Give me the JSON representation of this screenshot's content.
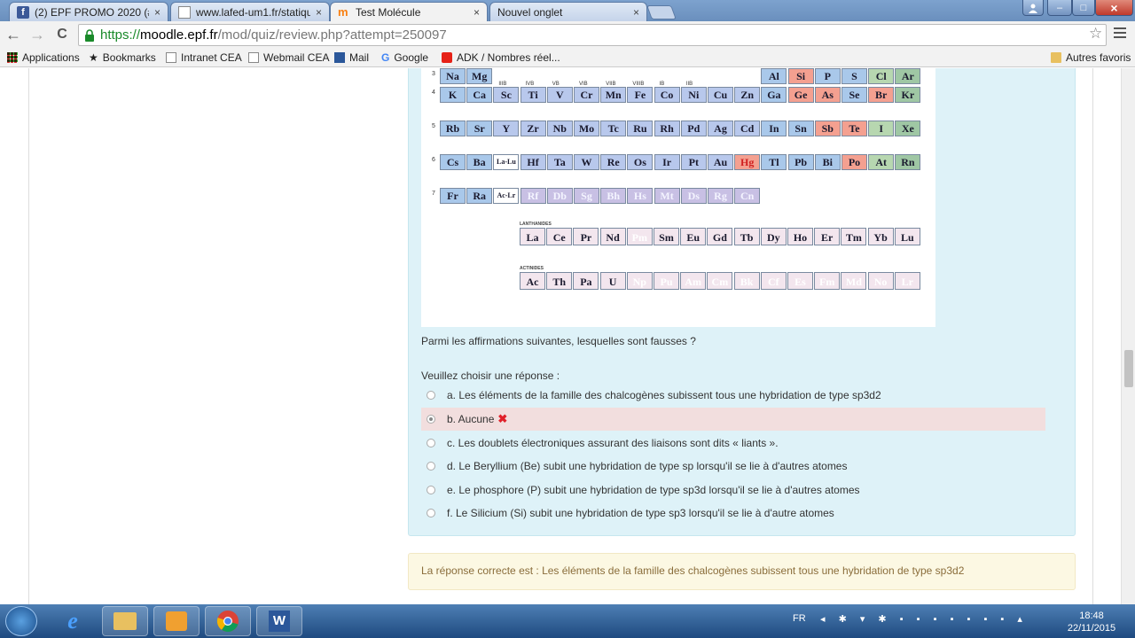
{
  "browser": {
    "tabs": [
      {
        "label": "(2) EPF PROMO 2020 (#C",
        "close": "×"
      },
      {
        "label": "www.lafed-um1.fr/statiqu",
        "close": "×"
      },
      {
        "label": "Test Molécule",
        "close": "×"
      },
      {
        "label": "Nouvel onglet",
        "close": "×"
      }
    ],
    "url": {
      "scheme": "https://",
      "host": "moodle.epf.fr",
      "path": "/mod/quiz/review.php?attempt=250097"
    },
    "bookmarks": [
      "Applications",
      "Bookmarks",
      "Intranet CEA",
      "Webmail CEA",
      "Mail",
      "Google",
      "ADK / Nombres réel...",
      "Autres favoris"
    ],
    "nav": {
      "back": "←",
      "forward": "→",
      "reload": "C",
      "star": "☆"
    },
    "window": {
      "minimize": "–",
      "maximize": "□",
      "close": "×"
    }
  },
  "periodic_table": {
    "group_labels": [
      "IIIB",
      "IVB",
      "VB",
      "VIB",
      "VIIB",
      "VIIIB",
      "IB",
      "IIB"
    ],
    "period_numbers": [
      "3",
      "4",
      "5",
      "6",
      "7"
    ],
    "rows": [
      [
        "Na",
        "Mg",
        "",
        "",
        "",
        "",
        "",
        "",
        "",
        "",
        "",
        "",
        "Al",
        "Si",
        "P",
        "S",
        "Cl",
        "Ar"
      ],
      [
        "K",
        "Ca",
        "Sc",
        "Ti",
        "V",
        "Cr",
        "Mn",
        "Fe",
        "Co",
        "Ni",
        "Cu",
        "Zn",
        "Ga",
        "Ge",
        "As",
        "Se",
        "Br",
        "Kr"
      ],
      [
        "Rb",
        "Sr",
        "Y",
        "Zr",
        "Nb",
        "Mo",
        "Tc",
        "Ru",
        "Rh",
        "Pd",
        "Ag",
        "Cd",
        "In",
        "Sn",
        "Sb",
        "Te",
        "I",
        "Xe"
      ],
      [
        "Cs",
        "Ba",
        "La-Lu",
        "Hf",
        "Ta",
        "W",
        "Re",
        "Os",
        "Ir",
        "Pt",
        "Au",
        "Hg",
        "Tl",
        "Pb",
        "Bi",
        "Po",
        "At",
        "Rn"
      ],
      [
        "Fr",
        "Ra",
        "Ac-Lr",
        "Rf",
        "Db",
        "Sg",
        "Bh",
        "Hs",
        "Mt",
        "Ds",
        "Rg",
        "Cn",
        "",
        "",
        "",
        "",
        "",
        ""
      ]
    ],
    "lanthanides_label": "LANTHANIDES",
    "lanthanides": [
      "La",
      "Ce",
      "Pr",
      "Nd",
      "Pm",
      "Sm",
      "Eu",
      "Gd",
      "Tb",
      "Dy",
      "Ho",
      "Er",
      "Tm",
      "Yb",
      "Lu"
    ],
    "actinides_label": "ACTINIDES",
    "actinides": [
      "Ac",
      "Th",
      "Pa",
      "U",
      "Np",
      "Pu",
      "Am",
      "Cm",
      "Bk",
      "Cf",
      "Es",
      "Fm",
      "Md",
      "No",
      "Lr"
    ]
  },
  "quiz": {
    "question": "Parmi les affirmations suivantes, lesquelles sont fausses ?",
    "prompt": "Veuillez choisir une réponse :",
    "answers": [
      "a. Les éléments de la famille des chalcogènes subissent tous une hybridation de type sp3d2",
      "b. Aucune",
      "c. Les doublets électroniques assurant des liaisons sont dits « liants ».",
      "d. Le Beryllium (Be) subit une hybridation de type sp lorsqu'il se lie à d'autres atomes",
      "e. Le phosphore (P) subit une hybridation de type sp3d  lorsqu'il se lie à d'autres atomes",
      "f. Le Silicium (Si) subit une hybridation de type sp3  lorsqu'il se lie à d'autre atomes"
    ],
    "selected_index": 1,
    "wrong_mark": "✖",
    "feedback": "La réponse correcte est : Les éléments de la famille des chalcogènes subissent tous une hybridation de type sp3d2"
  },
  "taskbar": {
    "lang": "FR",
    "time": "18:48",
    "date": "22/11/2015"
  }
}
